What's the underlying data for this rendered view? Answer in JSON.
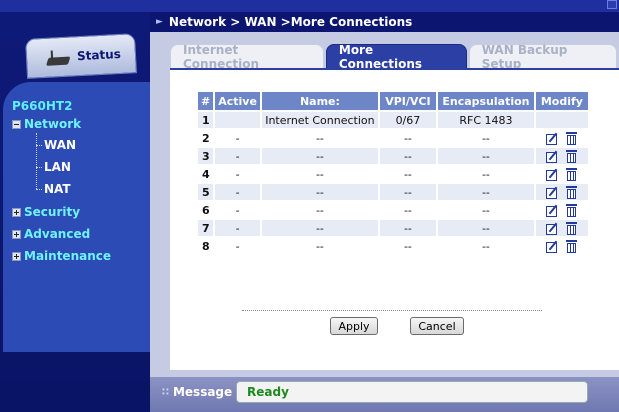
{
  "sidebar": {
    "status_label": "Status",
    "device_name": "P660HT2",
    "nav": {
      "network": "Network",
      "wan": "WAN",
      "lan": "LAN",
      "nat": "NAT",
      "security": "Security",
      "advanced": "Advanced",
      "maintenance": "Maintenance"
    }
  },
  "breadcrumb": "Network > WAN >More Connections",
  "tabs": [
    "Internet Connection",
    "More Connections",
    "WAN Backup Setup"
  ],
  "active_tab": 1,
  "table": {
    "headers": [
      "#",
      "Active",
      "Name:",
      "VPI/VCI",
      "Encapsulation",
      "Modify"
    ],
    "rows": [
      {
        "num": "1",
        "active": "",
        "name": "Internet Connection",
        "vpi": "0/67",
        "encap": "RFC 1483",
        "modify": false
      },
      {
        "num": "2",
        "active": "-",
        "name": "--",
        "vpi": "--",
        "encap": "--",
        "modify": true
      },
      {
        "num": "3",
        "active": "-",
        "name": "--",
        "vpi": "--",
        "encap": "--",
        "modify": true
      },
      {
        "num": "4",
        "active": "-",
        "name": "--",
        "vpi": "--",
        "encap": "--",
        "modify": true
      },
      {
        "num": "5",
        "active": "-",
        "name": "--",
        "vpi": "--",
        "encap": "--",
        "modify": true
      },
      {
        "num": "6",
        "active": "-",
        "name": "--",
        "vpi": "--",
        "encap": "--",
        "modify": true
      },
      {
        "num": "7",
        "active": "-",
        "name": "--",
        "vpi": "--",
        "encap": "--",
        "modify": true
      },
      {
        "num": "8",
        "active": "-",
        "name": "--",
        "vpi": "--",
        "encap": "--",
        "modify": true
      }
    ]
  },
  "buttons": {
    "apply": "Apply",
    "cancel": "Cancel"
  },
  "message": {
    "label": "Message",
    "value": "Ready"
  },
  "icons": {
    "edit": "edit-icon",
    "delete": "trash-icon",
    "status": "router-icon"
  },
  "colors": {
    "accent": "#2c3fa5",
    "header": "#6c86c8",
    "nav_text": "#6ff4ff",
    "ready": "#1e8a1e"
  }
}
